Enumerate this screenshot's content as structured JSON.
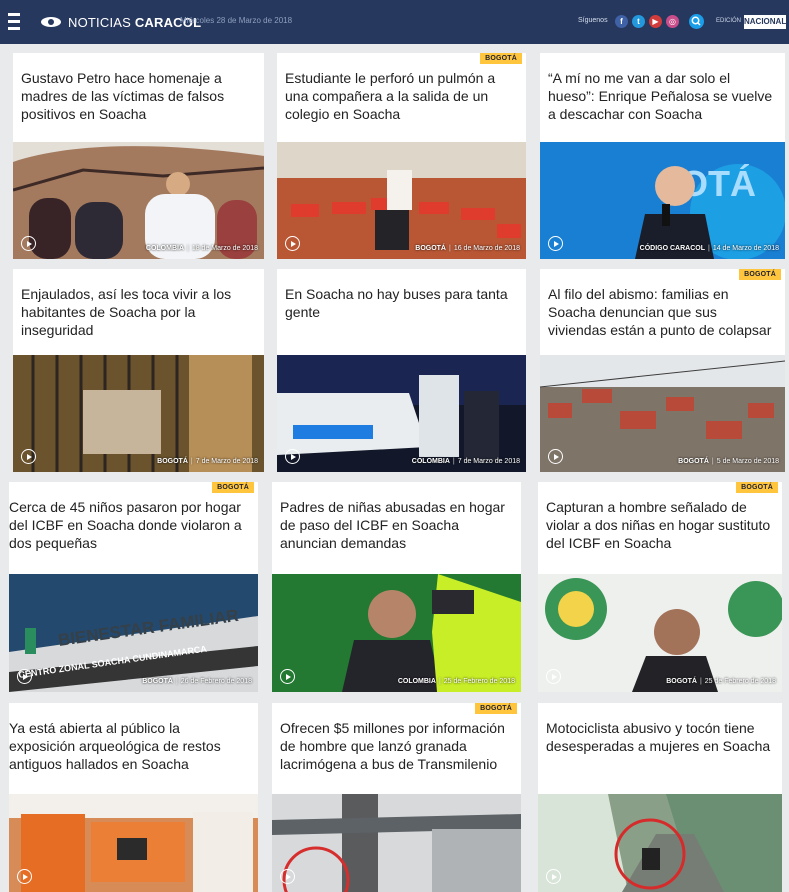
{
  "header": {
    "logo_brand": "NOTICIAS ",
    "logo_bold": "CARACOL",
    "date": "Miércoles 28 de Marzo de 2018",
    "follow_label": "Síguenos",
    "social": [
      "f",
      "t",
      "▶",
      "◎"
    ],
    "social_icons": [
      "facebook-icon",
      "twitter-icon",
      "youtube-icon",
      "instagram-icon"
    ],
    "edition_label": "EDICIÓN",
    "edition_value": "NACIONAL"
  },
  "articles": [
    {
      "title": "Gustavo Petro hace homenaje a madres de las víctimas de falsos positivos en Soacha",
      "section": "COLOMBIA",
      "date": "18 de Marzo de 2018"
    },
    {
      "badge": "BOGOTÁ",
      "title": "Estudiante le perforó un pulmón a una compañera a la salida de un colegio en Soacha",
      "section": "BOGOTÁ",
      "date": "16 de Marzo de 2018"
    },
    {
      "title": "“A mí no me van a dar solo el hueso”: Enrique Peñalosa se vuelve a descachar con Soacha",
      "section": "CÓDIGO CARACOL",
      "date": "14 de Marzo de 2018"
    },
    {
      "title": "Enjaulados, así les toca vivir a los habitantes de Soacha por la inseguridad",
      "section": "BOGOTÁ",
      "date": "7 de Marzo de 2018"
    },
    {
      "title": "En Soacha no hay buses para tanta gente",
      "section": "COLOMBIA",
      "date": "7 de Marzo de 2018"
    },
    {
      "badge": "BOGOTÁ",
      "title": "Al filo del abismo: familias en Soacha denuncian que sus viviendas están a punto de colapsar",
      "section": "BOGOTÁ",
      "date": "5 de Marzo de 2018"
    },
    {
      "badge": "BOGOTÁ",
      "title": "Cerca de 45 niños pasaron por hogar del ICBF en Soacha donde violaron a dos pequeñas",
      "section": "BOGOTÁ",
      "date": "26 de Febrero de 2018",
      "sign1": "BIENESTAR FAMILIAR",
      "sign2": "CENTRO ZONAL SOACHA CUNDINAMARCA"
    },
    {
      "title": "Padres de niñas abusadas en hogar de paso del ICBF en Soacha anuncian demandas",
      "section": "COLOMBIA",
      "date": "25 de Febrero de 2018"
    },
    {
      "badge": "BOGOTÁ",
      "title": "Capturan a hombre señalado de violar a dos niñas en hogar sustituto del ICBF en Soacha",
      "section": "BOGOTÁ",
      "date": "25 de Febrero de 2018"
    },
    {
      "title": "Ya está abierta al público la exposición arqueológica de restos antiguos hallados en Soacha"
    },
    {
      "badge": "BOGOTÁ",
      "title": "Ofrecen $5 millones por información de hombre que lanzó granada lacrimógena a bus de Transmilenio"
    },
    {
      "title": "Motociclista abusivo y tocón tiene desesperadas a mujeres en Soacha"
    }
  ],
  "colors": {
    "header": "#26385e",
    "badge": "#ffc53c",
    "search": "#1b9eea"
  }
}
